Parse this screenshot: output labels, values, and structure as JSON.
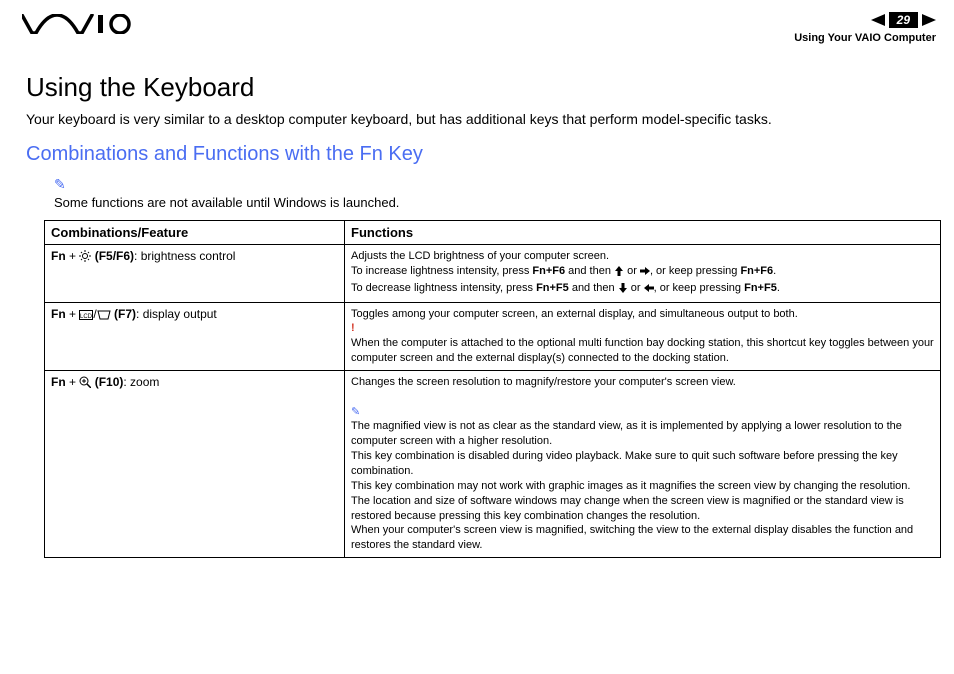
{
  "header": {
    "page_number": "29",
    "section": "Using Your VAIO Computer"
  },
  "title": "Using the Keyboard",
  "intro": "Your keyboard is very similar to a desktop computer keyboard, but has additional keys that perform model-specific tasks.",
  "subtitle": "Combinations and Functions with the Fn Key",
  "top_note": "Some functions are not available until Windows is launched.",
  "table": {
    "head": {
      "col1": "Combinations/Feature",
      "col2": "Functions"
    },
    "rows": [
      {
        "combo_prefix": "Fn",
        "combo_keys": "(F5/F6)",
        "combo_suffix": ": brightness control",
        "func": {
          "line1": "Adjusts the LCD brightness of your computer screen.",
          "inc_a": "To increase lightness intensity, press ",
          "inc_b": "Fn+F6",
          "inc_c": " and then ",
          "inc_d": " or ",
          "inc_e": ", or keep pressing ",
          "inc_f": "Fn+F6",
          "dec_a": "To decrease lightness intensity, press ",
          "dec_b": "Fn+F5",
          "dec_c": " and then ",
          "dec_d": " or ",
          "dec_e": ", or keep pressing ",
          "dec_f": "Fn+F5",
          "period": "."
        }
      },
      {
        "combo_prefix": "Fn",
        "combo_keys": "(F7)",
        "combo_suffix": ": display output",
        "func": {
          "line1": "Toggles among your computer screen, an external display, and simultaneous output to both.",
          "excl": "!",
          "warn": "When the computer is attached to the optional multi function bay docking station, this shortcut key toggles between your computer screen and the external display(s) connected to the docking station."
        }
      },
      {
        "combo_prefix": "Fn",
        "combo_keys": "(F10)",
        "combo_suffix": ": zoom",
        "func": {
          "line1": "Changes the screen resolution to magnify/restore your computer's screen view.",
          "p1": "The magnified view is not as clear as the standard view, as it is implemented by applying a lower resolution to the computer screen with a higher resolution.",
          "p2": "This key combination is disabled during video playback. Make sure to quit such software before pressing the key combination.",
          "p3": "This key combination may not work with graphic images as it magnifies the screen view by changing the resolution.",
          "p4": "The location and size of software windows may change when the screen view is magnified or the standard view is restored because pressing this key combination changes the resolution.",
          "p5": "When your computer's screen view is magnified, switching the view to the external display disables the function and restores the standard view."
        }
      }
    ]
  }
}
